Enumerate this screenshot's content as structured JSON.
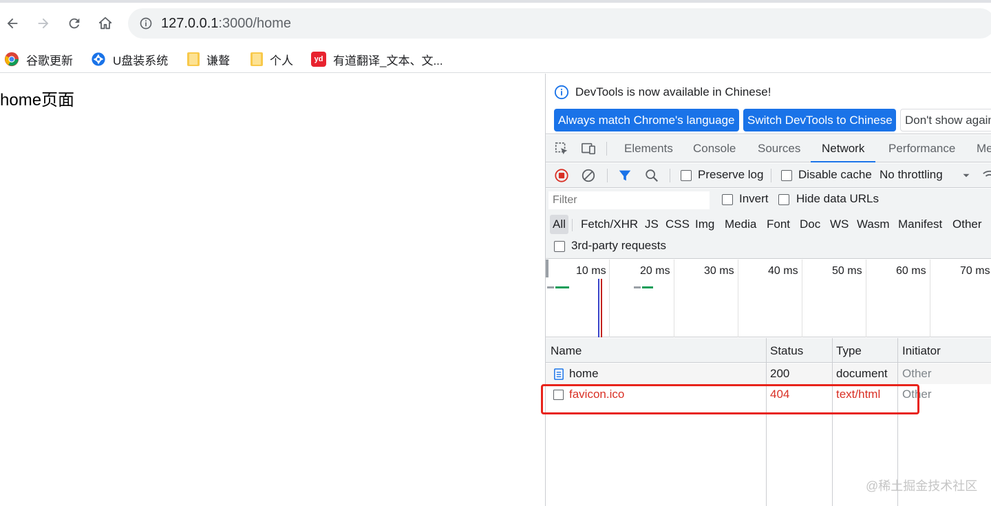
{
  "browser": {
    "url_host": "127.0.0.1",
    "url_path": ":3000/home",
    "bookmarks": [
      {
        "label": "谷歌更新",
        "icon": "chrome-icon"
      },
      {
        "label": "U盘装系统",
        "icon": "aperture-icon"
      },
      {
        "label": "谦聱",
        "icon": "folder-icon"
      },
      {
        "label": "个人",
        "icon": "folder-icon"
      },
      {
        "label": "有道翻译_文本、文...",
        "icon": "youdao-icon"
      }
    ]
  },
  "page": {
    "text": "home页面"
  },
  "devtools": {
    "banner": {
      "message": "DevTools is now available in Chinese!",
      "btn_match": "Always match Chrome's language",
      "btn_switch": "Switch DevTools to Chinese",
      "btn_dismiss": "Don't show again"
    },
    "tabs": [
      "Elements",
      "Console",
      "Sources",
      "Network",
      "Performance",
      "Me"
    ],
    "active_tab": "Network",
    "toolbar": {
      "preserve_log": "Preserve log",
      "disable_cache": "Disable cache",
      "throttling": "No throttling"
    },
    "filter": {
      "placeholder": "Filter",
      "invert": "Invert",
      "hide_data_urls": "Hide data URLs",
      "types": [
        "All",
        "Fetch/XHR",
        "JS",
        "CSS",
        "Img",
        "Media",
        "Font",
        "Doc",
        "WS",
        "Wasm",
        "Manifest",
        "Other"
      ],
      "third_party": "3rd-party requests"
    },
    "timeline": {
      "ticks": [
        "10 ms",
        "20 ms",
        "30 ms",
        "40 ms",
        "50 ms",
        "60 ms",
        "70 ms"
      ]
    },
    "table": {
      "headers": {
        "name": "Name",
        "status": "Status",
        "type": "Type",
        "initiator": "Initiator"
      },
      "rows": [
        {
          "name": "home",
          "status": "200",
          "type": "document",
          "initiator": "Other"
        },
        {
          "name": "favicon.ico",
          "status": "404",
          "type": "text/html",
          "initiator": "Other"
        }
      ]
    }
  },
  "watermark": "@稀土掘金技术社区",
  "colors": {
    "accent": "#1a73e8",
    "error": "#d93025",
    "highlight": "#e8231a"
  }
}
